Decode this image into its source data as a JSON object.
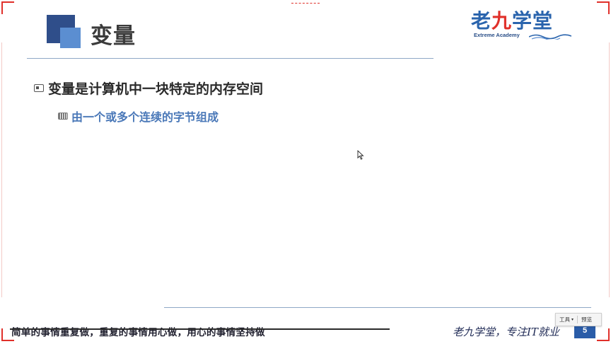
{
  "slide": {
    "title": "变量",
    "bullet_level1": "变量是计算机中一块特定的内存空间",
    "bullet_level2": "由一个或多个连续的字节组成",
    "page_number": "5"
  },
  "logo": {
    "main_part1": "老",
    "main_part2": "九",
    "main_part3": "学堂",
    "subtitle": "Extreme Academy"
  },
  "footer": {
    "slogan": "简单的事情重复做，重复的事情用心做，用心的事情坚持做",
    "brand": "老九学堂，专注IT就业"
  },
  "toolbar": {
    "tools_label": "工具",
    "preview_label": "预览"
  },
  "colors": {
    "accent_dark": "#2f4e8a",
    "accent_light": "#5b8ed1",
    "sub_bullet_text": "#4a78b8",
    "frame_red": "#e0302a"
  }
}
